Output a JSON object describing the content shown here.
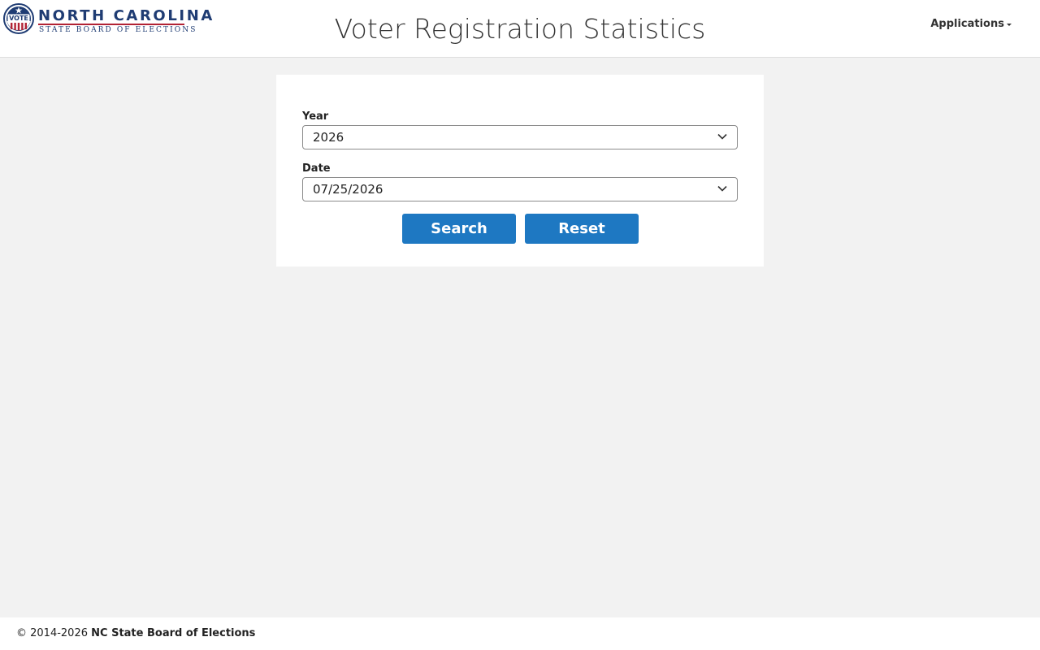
{
  "header": {
    "logo": {
      "seal_text": "VOTE",
      "name": "NORTH CAROLINA",
      "subtitle": "STATE BOARD OF ELECTIONS"
    },
    "title": "Voter Registration Statistics",
    "applications_menu_label": "Applications"
  },
  "form": {
    "year": {
      "label": "Year",
      "selected": "2026"
    },
    "date": {
      "label": "Date",
      "selected": "07/25/2026"
    },
    "search_label": "Search",
    "reset_label": "Reset"
  },
  "footer": {
    "copyright": "© 2014-2026",
    "organization": "NC State Board of Elections"
  },
  "colors": {
    "primary_button": "#1e78c2",
    "brand_navy": "#1f3c73",
    "brand_red": "#b22234",
    "page_background": "#f2f2f2"
  }
}
